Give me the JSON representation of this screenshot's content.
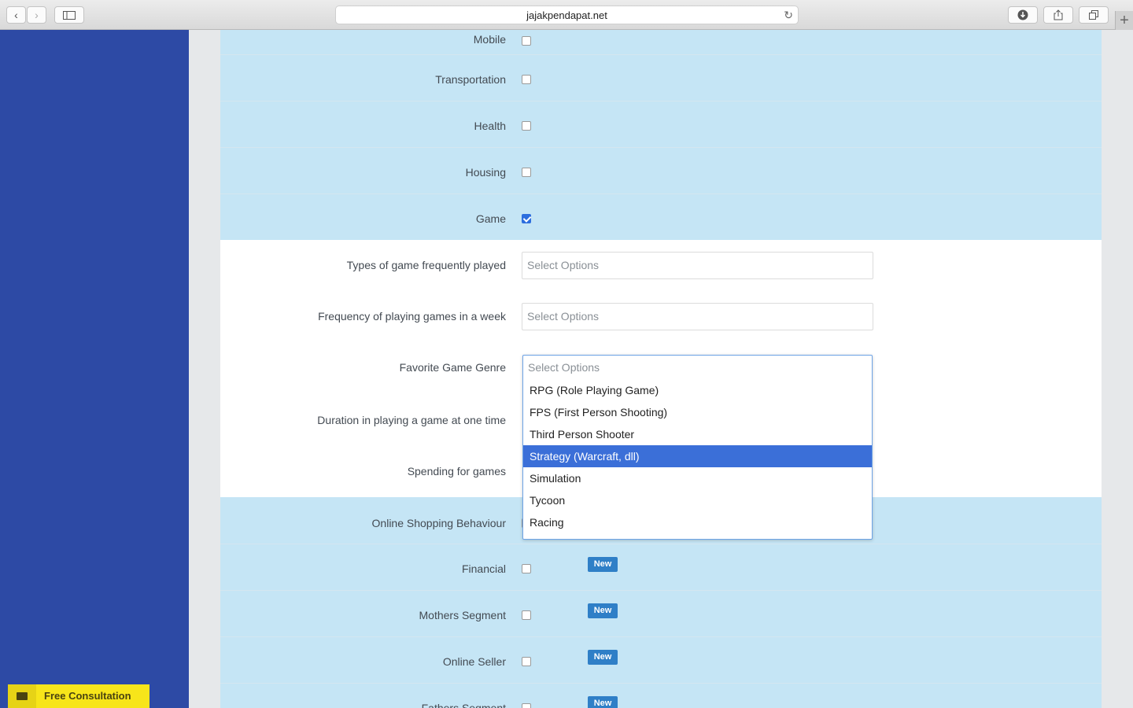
{
  "browser": {
    "url": "jajakpendapat.net",
    "back_icon": "‹",
    "forward_icon": "›",
    "plus_label": "+"
  },
  "interest_rows": [
    {
      "label": "Mobile",
      "checked": false
    },
    {
      "label": "Transportation",
      "checked": false
    },
    {
      "label": "Health",
      "checked": false
    },
    {
      "label": "Housing",
      "checked": false
    },
    {
      "label": "Game",
      "checked": true
    }
  ],
  "game_fields": [
    {
      "label": "Types of game frequently played",
      "placeholder": "Select Options"
    },
    {
      "label": "Frequency of playing games in a week",
      "placeholder": "Select Options"
    },
    {
      "label": "Favorite Game Genre",
      "placeholder": "Select Options"
    },
    {
      "label": "Duration in playing a game at one time",
      "placeholder": ""
    },
    {
      "label": "Spending for games",
      "placeholder": ""
    }
  ],
  "genre_dropdown": {
    "placeholder": "Select Options",
    "options": [
      "RPG (Role Playing Game)",
      "FPS (First Person Shooting)",
      "Third Person Shooter",
      "Strategy (Warcraft, dll)",
      "Simulation",
      "Tycoon",
      "Racing"
    ],
    "highlighted": "Strategy (Warcraft, dll)"
  },
  "segment_rows": [
    {
      "label": "Online Shopping Behaviour",
      "checked": false,
      "badge": ""
    },
    {
      "label": "Financial",
      "checked": false,
      "badge": "New"
    },
    {
      "label": "Mothers Segment",
      "checked": false,
      "badge": "New"
    },
    {
      "label": "Online Seller",
      "checked": false,
      "badge": "New"
    },
    {
      "label": "Fathers Segment",
      "checked": false,
      "badge": "New"
    }
  ],
  "consultation": {
    "label": "Free Consultation",
    "icon": "envelope-icon"
  },
  "colors": {
    "sidebar": "#2d4aa5",
    "row_blue": "#c5e5f5",
    "accent": "#3b6fd8",
    "badge": "#2f7fc7",
    "consult": "#f7e51a"
  }
}
